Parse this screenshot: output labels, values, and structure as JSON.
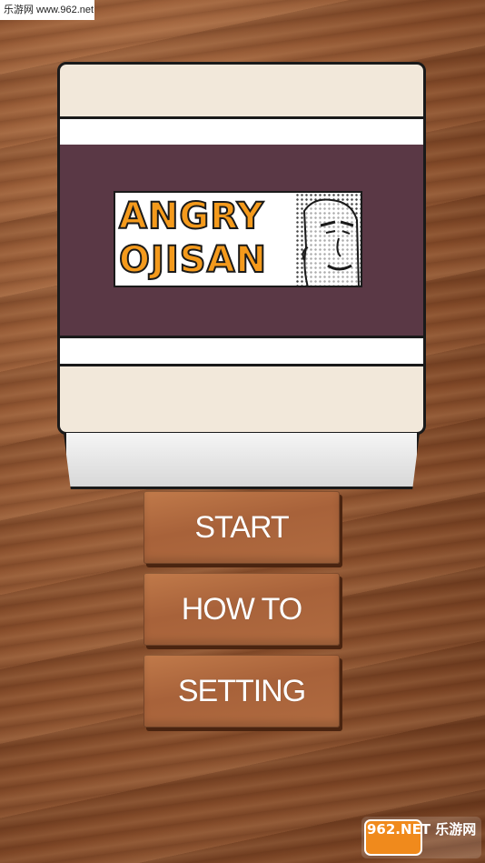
{
  "watermark": {
    "top_left": "乐游网 www.962.net",
    "bottom_right": "962.NET 乐游网"
  },
  "logo": {
    "line1": "ANGRY",
    "line2": "OJISAN"
  },
  "menu": {
    "start_label": "START",
    "howto_label": "HOW TO",
    "setting_label": "SETTING"
  },
  "colors": {
    "band": "#5a3845",
    "cup": "#f2e8da",
    "logo_text": "#f49a1c",
    "button_wood": "#b06b40"
  }
}
